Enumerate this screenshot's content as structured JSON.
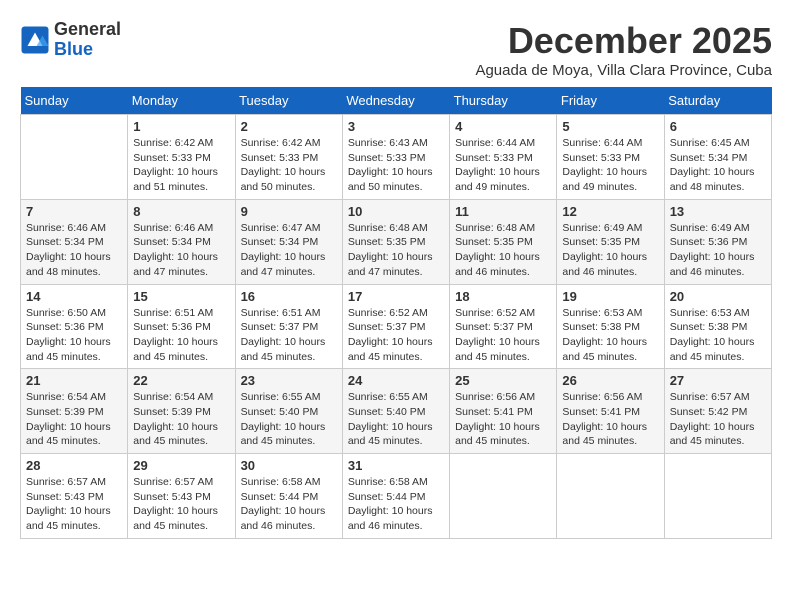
{
  "logo": {
    "general": "General",
    "blue": "Blue"
  },
  "title": "December 2025",
  "subtitle": "Aguada de Moya, Villa Clara Province, Cuba",
  "days_of_week": [
    "Sunday",
    "Monday",
    "Tuesday",
    "Wednesday",
    "Thursday",
    "Friday",
    "Saturday"
  ],
  "weeks": [
    [
      {
        "day": "",
        "sunrise": "",
        "sunset": "",
        "daylight": ""
      },
      {
        "day": "1",
        "sunrise": "Sunrise: 6:42 AM",
        "sunset": "Sunset: 5:33 PM",
        "daylight": "Daylight: 10 hours and 51 minutes."
      },
      {
        "day": "2",
        "sunrise": "Sunrise: 6:42 AM",
        "sunset": "Sunset: 5:33 PM",
        "daylight": "Daylight: 10 hours and 50 minutes."
      },
      {
        "day": "3",
        "sunrise": "Sunrise: 6:43 AM",
        "sunset": "Sunset: 5:33 PM",
        "daylight": "Daylight: 10 hours and 50 minutes."
      },
      {
        "day": "4",
        "sunrise": "Sunrise: 6:44 AM",
        "sunset": "Sunset: 5:33 PM",
        "daylight": "Daylight: 10 hours and 49 minutes."
      },
      {
        "day": "5",
        "sunrise": "Sunrise: 6:44 AM",
        "sunset": "Sunset: 5:33 PM",
        "daylight": "Daylight: 10 hours and 49 minutes."
      },
      {
        "day": "6",
        "sunrise": "Sunrise: 6:45 AM",
        "sunset": "Sunset: 5:34 PM",
        "daylight": "Daylight: 10 hours and 48 minutes."
      }
    ],
    [
      {
        "day": "7",
        "sunrise": "Sunrise: 6:46 AM",
        "sunset": "Sunset: 5:34 PM",
        "daylight": "Daylight: 10 hours and 48 minutes."
      },
      {
        "day": "8",
        "sunrise": "Sunrise: 6:46 AM",
        "sunset": "Sunset: 5:34 PM",
        "daylight": "Daylight: 10 hours and 47 minutes."
      },
      {
        "day": "9",
        "sunrise": "Sunrise: 6:47 AM",
        "sunset": "Sunset: 5:34 PM",
        "daylight": "Daylight: 10 hours and 47 minutes."
      },
      {
        "day": "10",
        "sunrise": "Sunrise: 6:48 AM",
        "sunset": "Sunset: 5:35 PM",
        "daylight": "Daylight: 10 hours and 47 minutes."
      },
      {
        "day": "11",
        "sunrise": "Sunrise: 6:48 AM",
        "sunset": "Sunset: 5:35 PM",
        "daylight": "Daylight: 10 hours and 46 minutes."
      },
      {
        "day": "12",
        "sunrise": "Sunrise: 6:49 AM",
        "sunset": "Sunset: 5:35 PM",
        "daylight": "Daylight: 10 hours and 46 minutes."
      },
      {
        "day": "13",
        "sunrise": "Sunrise: 6:49 AM",
        "sunset": "Sunset: 5:36 PM",
        "daylight": "Daylight: 10 hours and 46 minutes."
      }
    ],
    [
      {
        "day": "14",
        "sunrise": "Sunrise: 6:50 AM",
        "sunset": "Sunset: 5:36 PM",
        "daylight": "Daylight: 10 hours and 45 minutes."
      },
      {
        "day": "15",
        "sunrise": "Sunrise: 6:51 AM",
        "sunset": "Sunset: 5:36 PM",
        "daylight": "Daylight: 10 hours and 45 minutes."
      },
      {
        "day": "16",
        "sunrise": "Sunrise: 6:51 AM",
        "sunset": "Sunset: 5:37 PM",
        "daylight": "Daylight: 10 hours and 45 minutes."
      },
      {
        "day": "17",
        "sunrise": "Sunrise: 6:52 AM",
        "sunset": "Sunset: 5:37 PM",
        "daylight": "Daylight: 10 hours and 45 minutes."
      },
      {
        "day": "18",
        "sunrise": "Sunrise: 6:52 AM",
        "sunset": "Sunset: 5:37 PM",
        "daylight": "Daylight: 10 hours and 45 minutes."
      },
      {
        "day": "19",
        "sunrise": "Sunrise: 6:53 AM",
        "sunset": "Sunset: 5:38 PM",
        "daylight": "Daylight: 10 hours and 45 minutes."
      },
      {
        "day": "20",
        "sunrise": "Sunrise: 6:53 AM",
        "sunset": "Sunset: 5:38 PM",
        "daylight": "Daylight: 10 hours and 45 minutes."
      }
    ],
    [
      {
        "day": "21",
        "sunrise": "Sunrise: 6:54 AM",
        "sunset": "Sunset: 5:39 PM",
        "daylight": "Daylight: 10 hours and 45 minutes."
      },
      {
        "day": "22",
        "sunrise": "Sunrise: 6:54 AM",
        "sunset": "Sunset: 5:39 PM",
        "daylight": "Daylight: 10 hours and 45 minutes."
      },
      {
        "day": "23",
        "sunrise": "Sunrise: 6:55 AM",
        "sunset": "Sunset: 5:40 PM",
        "daylight": "Daylight: 10 hours and 45 minutes."
      },
      {
        "day": "24",
        "sunrise": "Sunrise: 6:55 AM",
        "sunset": "Sunset: 5:40 PM",
        "daylight": "Daylight: 10 hours and 45 minutes."
      },
      {
        "day": "25",
        "sunrise": "Sunrise: 6:56 AM",
        "sunset": "Sunset: 5:41 PM",
        "daylight": "Daylight: 10 hours and 45 minutes."
      },
      {
        "day": "26",
        "sunrise": "Sunrise: 6:56 AM",
        "sunset": "Sunset: 5:41 PM",
        "daylight": "Daylight: 10 hours and 45 minutes."
      },
      {
        "day": "27",
        "sunrise": "Sunrise: 6:57 AM",
        "sunset": "Sunset: 5:42 PM",
        "daylight": "Daylight: 10 hours and 45 minutes."
      }
    ],
    [
      {
        "day": "28",
        "sunrise": "Sunrise: 6:57 AM",
        "sunset": "Sunset: 5:43 PM",
        "daylight": "Daylight: 10 hours and 45 minutes."
      },
      {
        "day": "29",
        "sunrise": "Sunrise: 6:57 AM",
        "sunset": "Sunset: 5:43 PM",
        "daylight": "Daylight: 10 hours and 45 minutes."
      },
      {
        "day": "30",
        "sunrise": "Sunrise: 6:58 AM",
        "sunset": "Sunset: 5:44 PM",
        "daylight": "Daylight: 10 hours and 46 minutes."
      },
      {
        "day": "31",
        "sunrise": "Sunrise: 6:58 AM",
        "sunset": "Sunset: 5:44 PM",
        "daylight": "Daylight: 10 hours and 46 minutes."
      },
      {
        "day": "",
        "sunrise": "",
        "sunset": "",
        "daylight": ""
      },
      {
        "day": "",
        "sunrise": "",
        "sunset": "",
        "daylight": ""
      },
      {
        "day": "",
        "sunrise": "",
        "sunset": "",
        "daylight": ""
      }
    ]
  ]
}
